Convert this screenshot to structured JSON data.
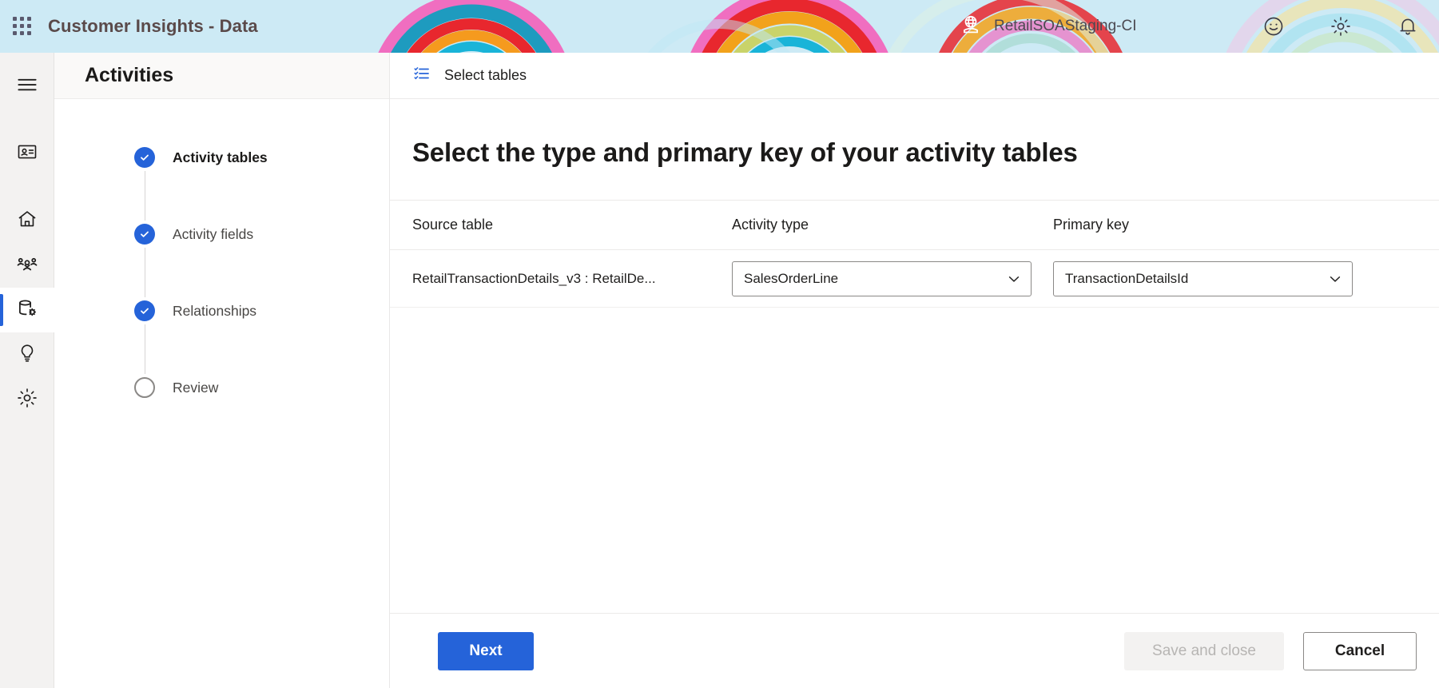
{
  "topbar": {
    "waffle_icon": "app-launcher-waffle",
    "app_title": "Customer Insights - Data",
    "environment": {
      "icon": "environment-globe-icon",
      "name": "RetailSOAStaging-CI"
    },
    "icons": [
      {
        "name": "smiley-feedback-icon",
        "glyph": "smiley"
      },
      {
        "name": "settings-gear-icon",
        "glyph": "gear"
      },
      {
        "name": "notifications-bell-icon",
        "glyph": "bell"
      }
    ]
  },
  "rail": {
    "hamburger_label": "hamburger-menu",
    "items": [
      {
        "name": "profiles",
        "icon": "contact-card-icon",
        "selected": false
      },
      {
        "name": "home",
        "icon": "home-icon",
        "selected": false
      },
      {
        "name": "audiences",
        "icon": "people-group-icon",
        "selected": false
      },
      {
        "name": "data",
        "icon": "database-gear-icon",
        "selected": true
      },
      {
        "name": "insights",
        "icon": "lightbulb-icon",
        "selected": false
      },
      {
        "name": "settings",
        "icon": "gear-icon",
        "selected": false
      }
    ]
  },
  "page": {
    "title": "Activities"
  },
  "wizard": {
    "steps": [
      {
        "label": "Activity tables",
        "state": "done",
        "active": true
      },
      {
        "label": "Activity fields",
        "state": "done",
        "active": false
      },
      {
        "label": "Relationships",
        "state": "done",
        "active": false
      },
      {
        "label": "Review",
        "state": "todo",
        "active": false
      }
    ]
  },
  "breadcrumb": {
    "icon": "bulleted-list-icon",
    "label": "Select tables"
  },
  "main": {
    "heading": "Select the type and primary key of your activity tables",
    "table": {
      "columns": [
        "Source table",
        "Activity type",
        "Primary key"
      ],
      "rows": [
        {
          "source_table": "RetailTransactionDetails_v3 : RetailDe...",
          "activity_type": "SalesOrderLine",
          "primary_key": "TransactionDetailsId"
        }
      ]
    }
  },
  "footer": {
    "next_label": "Next",
    "save_and_close_label": "Save and close",
    "cancel_label": "Cancel"
  },
  "colors": {
    "topbar_bg": "#cdeaf5",
    "accent_blue": "#2563d9",
    "rail_bg": "#f3f2f1",
    "page_header_bg": "#faf9f8",
    "disabled_bg": "#f3f2f1",
    "disabled_text": "#b7b5b3"
  }
}
